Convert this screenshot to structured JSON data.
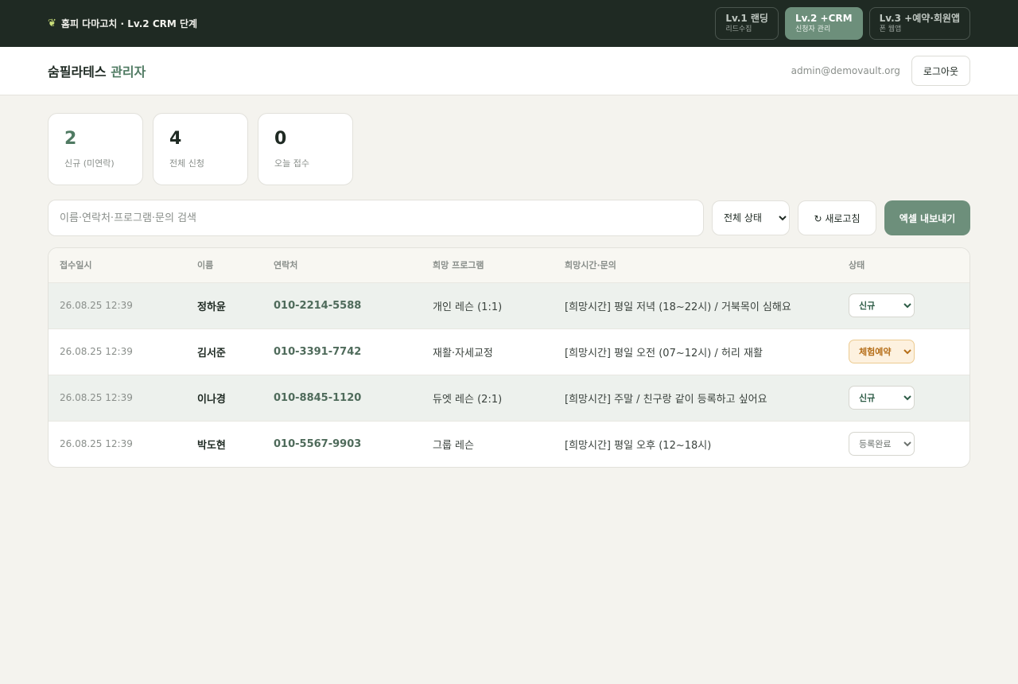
{
  "topbar": {
    "brand": "홈피 다마고치 · Lv.2 CRM 단계",
    "levels": [
      {
        "title": "Lv.1 랜딩",
        "sub": "리드수집"
      },
      {
        "title": "Lv.2 +CRM",
        "sub": "신청자 관리"
      },
      {
        "title": "Lv.3 +예약·회원앱",
        "sub": "폰 웹앱"
      }
    ]
  },
  "header": {
    "title_main": "숨필라테스",
    "title_accent": "관리자",
    "email": "admin@demovault.org",
    "logout": "로그아웃"
  },
  "stats": [
    {
      "value": "2",
      "label": "신규 (미연락)"
    },
    {
      "value": "4",
      "label": "전체 신청"
    },
    {
      "value": "0",
      "label": "오늘 접수"
    }
  ],
  "toolbar": {
    "search_placeholder": "이름·연락처·프로그램·문의 검색",
    "status_filter": "전체 상태",
    "refresh": "↻ 새로고침",
    "export": "엑셀 내보내기"
  },
  "table": {
    "headers": [
      "접수일시",
      "이름",
      "연락처",
      "희망 프로그램",
      "희망시간·문의",
      "상태"
    ],
    "rows": [
      {
        "date": "26.08.25 12:39",
        "name": "정하윤",
        "phone": "010-2214-5588",
        "program": "개인 레슨 (1:1)",
        "inquiry": "[희망시간] 평일 저녁 (18~22시) / 거북목이 심해요",
        "status": "신규"
      },
      {
        "date": "26.08.25 12:39",
        "name": "김서준",
        "phone": "010-3391-7742",
        "program": "재활·자세교정",
        "inquiry": "[희망시간] 평일 오전 (07~12시) / 허리 재활",
        "status": "체험예약"
      },
      {
        "date": "26.08.25 12:39",
        "name": "이나경",
        "phone": "010-8845-1120",
        "program": "듀엣 레슨 (2:1)",
        "inquiry": "[희망시간] 주말 / 친구랑 같이 등록하고 싶어요",
        "status": "신규"
      },
      {
        "date": "26.08.25 12:39",
        "name": "박도현",
        "phone": "010-5567-9903",
        "program": "그룹 레슨",
        "inquiry": "[희망시간] 평일 오후 (12~18시)",
        "status": "등록완료"
      }
    ]
  },
  "colors": {
    "topbar_bg": "#1f2a23",
    "accent": "#6d8f7b",
    "highlight_row": "#edf1ed",
    "warn_badge": "#fdf1df"
  }
}
